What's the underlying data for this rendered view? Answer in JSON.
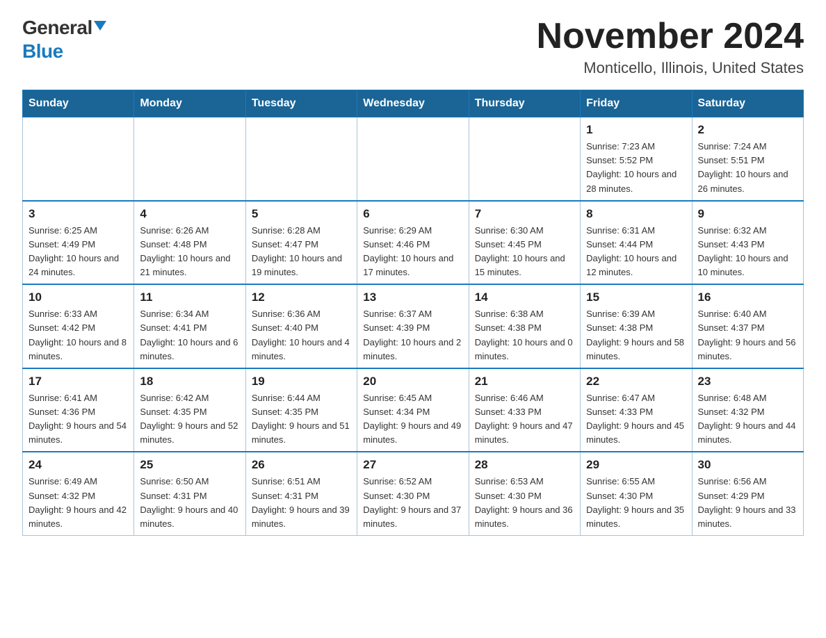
{
  "header": {
    "logo_general": "General",
    "logo_blue": "Blue",
    "title": "November 2024",
    "location": "Monticello, Illinois, United States"
  },
  "days_of_week": [
    "Sunday",
    "Monday",
    "Tuesday",
    "Wednesday",
    "Thursday",
    "Friday",
    "Saturday"
  ],
  "weeks": [
    [
      {
        "day": "",
        "sunrise": "",
        "sunset": "",
        "daylight": ""
      },
      {
        "day": "",
        "sunrise": "",
        "sunset": "",
        "daylight": ""
      },
      {
        "day": "",
        "sunrise": "",
        "sunset": "",
        "daylight": ""
      },
      {
        "day": "",
        "sunrise": "",
        "sunset": "",
        "daylight": ""
      },
      {
        "day": "",
        "sunrise": "",
        "sunset": "",
        "daylight": ""
      },
      {
        "day": "1",
        "sunrise": "Sunrise: 7:23 AM",
        "sunset": "Sunset: 5:52 PM",
        "daylight": "Daylight: 10 hours and 28 minutes."
      },
      {
        "day": "2",
        "sunrise": "Sunrise: 7:24 AM",
        "sunset": "Sunset: 5:51 PM",
        "daylight": "Daylight: 10 hours and 26 minutes."
      }
    ],
    [
      {
        "day": "3",
        "sunrise": "Sunrise: 6:25 AM",
        "sunset": "Sunset: 4:49 PM",
        "daylight": "Daylight: 10 hours and 24 minutes."
      },
      {
        "day": "4",
        "sunrise": "Sunrise: 6:26 AM",
        "sunset": "Sunset: 4:48 PM",
        "daylight": "Daylight: 10 hours and 21 minutes."
      },
      {
        "day": "5",
        "sunrise": "Sunrise: 6:28 AM",
        "sunset": "Sunset: 4:47 PM",
        "daylight": "Daylight: 10 hours and 19 minutes."
      },
      {
        "day": "6",
        "sunrise": "Sunrise: 6:29 AM",
        "sunset": "Sunset: 4:46 PM",
        "daylight": "Daylight: 10 hours and 17 minutes."
      },
      {
        "day": "7",
        "sunrise": "Sunrise: 6:30 AM",
        "sunset": "Sunset: 4:45 PM",
        "daylight": "Daylight: 10 hours and 15 minutes."
      },
      {
        "day": "8",
        "sunrise": "Sunrise: 6:31 AM",
        "sunset": "Sunset: 4:44 PM",
        "daylight": "Daylight: 10 hours and 12 minutes."
      },
      {
        "day": "9",
        "sunrise": "Sunrise: 6:32 AM",
        "sunset": "Sunset: 4:43 PM",
        "daylight": "Daylight: 10 hours and 10 minutes."
      }
    ],
    [
      {
        "day": "10",
        "sunrise": "Sunrise: 6:33 AM",
        "sunset": "Sunset: 4:42 PM",
        "daylight": "Daylight: 10 hours and 8 minutes."
      },
      {
        "day": "11",
        "sunrise": "Sunrise: 6:34 AM",
        "sunset": "Sunset: 4:41 PM",
        "daylight": "Daylight: 10 hours and 6 minutes."
      },
      {
        "day": "12",
        "sunrise": "Sunrise: 6:36 AM",
        "sunset": "Sunset: 4:40 PM",
        "daylight": "Daylight: 10 hours and 4 minutes."
      },
      {
        "day": "13",
        "sunrise": "Sunrise: 6:37 AM",
        "sunset": "Sunset: 4:39 PM",
        "daylight": "Daylight: 10 hours and 2 minutes."
      },
      {
        "day": "14",
        "sunrise": "Sunrise: 6:38 AM",
        "sunset": "Sunset: 4:38 PM",
        "daylight": "Daylight: 10 hours and 0 minutes."
      },
      {
        "day": "15",
        "sunrise": "Sunrise: 6:39 AM",
        "sunset": "Sunset: 4:38 PM",
        "daylight": "Daylight: 9 hours and 58 minutes."
      },
      {
        "day": "16",
        "sunrise": "Sunrise: 6:40 AM",
        "sunset": "Sunset: 4:37 PM",
        "daylight": "Daylight: 9 hours and 56 minutes."
      }
    ],
    [
      {
        "day": "17",
        "sunrise": "Sunrise: 6:41 AM",
        "sunset": "Sunset: 4:36 PM",
        "daylight": "Daylight: 9 hours and 54 minutes."
      },
      {
        "day": "18",
        "sunrise": "Sunrise: 6:42 AM",
        "sunset": "Sunset: 4:35 PM",
        "daylight": "Daylight: 9 hours and 52 minutes."
      },
      {
        "day": "19",
        "sunrise": "Sunrise: 6:44 AM",
        "sunset": "Sunset: 4:35 PM",
        "daylight": "Daylight: 9 hours and 51 minutes."
      },
      {
        "day": "20",
        "sunrise": "Sunrise: 6:45 AM",
        "sunset": "Sunset: 4:34 PM",
        "daylight": "Daylight: 9 hours and 49 minutes."
      },
      {
        "day": "21",
        "sunrise": "Sunrise: 6:46 AM",
        "sunset": "Sunset: 4:33 PM",
        "daylight": "Daylight: 9 hours and 47 minutes."
      },
      {
        "day": "22",
        "sunrise": "Sunrise: 6:47 AM",
        "sunset": "Sunset: 4:33 PM",
        "daylight": "Daylight: 9 hours and 45 minutes."
      },
      {
        "day": "23",
        "sunrise": "Sunrise: 6:48 AM",
        "sunset": "Sunset: 4:32 PM",
        "daylight": "Daylight: 9 hours and 44 minutes."
      }
    ],
    [
      {
        "day": "24",
        "sunrise": "Sunrise: 6:49 AM",
        "sunset": "Sunset: 4:32 PM",
        "daylight": "Daylight: 9 hours and 42 minutes."
      },
      {
        "day": "25",
        "sunrise": "Sunrise: 6:50 AM",
        "sunset": "Sunset: 4:31 PM",
        "daylight": "Daylight: 9 hours and 40 minutes."
      },
      {
        "day": "26",
        "sunrise": "Sunrise: 6:51 AM",
        "sunset": "Sunset: 4:31 PM",
        "daylight": "Daylight: 9 hours and 39 minutes."
      },
      {
        "day": "27",
        "sunrise": "Sunrise: 6:52 AM",
        "sunset": "Sunset: 4:30 PM",
        "daylight": "Daylight: 9 hours and 37 minutes."
      },
      {
        "day": "28",
        "sunrise": "Sunrise: 6:53 AM",
        "sunset": "Sunset: 4:30 PM",
        "daylight": "Daylight: 9 hours and 36 minutes."
      },
      {
        "day": "29",
        "sunrise": "Sunrise: 6:55 AM",
        "sunset": "Sunset: 4:30 PM",
        "daylight": "Daylight: 9 hours and 35 minutes."
      },
      {
        "day": "30",
        "sunrise": "Sunrise: 6:56 AM",
        "sunset": "Sunset: 4:29 PM",
        "daylight": "Daylight: 9 hours and 33 minutes."
      }
    ]
  ]
}
